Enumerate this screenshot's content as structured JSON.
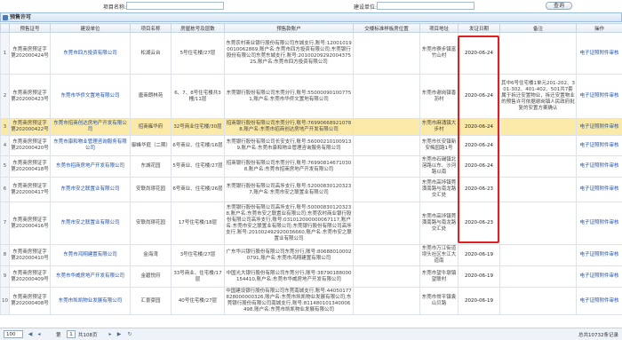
{
  "search": {
    "project_label": "项目名称:",
    "company_label": "建设单位:",
    "project_value": "",
    "company_value": "",
    "button": "查询"
  },
  "panel_title": "预售许可",
  "columns": [
    "",
    "预售证号",
    "建设单位",
    "项目名称",
    "房屋栋号及层数",
    "预售款账户",
    "交楼标准样板房位置",
    "项目地址",
    "发证日期",
    "备注",
    "操作"
  ],
  "rows": [
    {
      "n": "1",
      "cert": "东莞商房预证字第202000424号",
      "company": "东莞市四方投资有限公司",
      "project": "松湖云台",
      "bld": "5号住宅楼/27层",
      "account": "东莞农村商业银行股份有限公司东城支行,账号:120010190010062869,账户名:东莞市四方投资有限公司;东莞银行股份有限公司东莞东城支行,账号:201002092920043752S,账户名:东莞市四方投资有限公司",
      "sample": "",
      "addr": "东莞市寮步镇富竹山村",
      "date": "2020-06-24",
      "remark": "",
      "op": "电子证照附件审核"
    },
    {
      "n": "2",
      "cert": "东莞商房预证字第202000423号",
      "company": "东莞市华侨文置地有限公司",
      "project": "唐商朗林苑",
      "bld": "6、7、8号住宅楼共3幢/11层",
      "account": "东莞银行股份有限公司东莞分行,账号:550000901007751,账户名:东莞市华侨文置地有限公司",
      "sample": "",
      "addr": "东莞市谢岗镇香沥村",
      "date": "2020-06-24",
      "remark": "其中6号住宅楼1单元201-202、301-302、401-402、501共7套属于拆迁安置物业，拆迁安置物业的预售许可依据谢岗镇人民政府批复的安置方案确认",
      "op": "电子证照附件审核"
    },
    {
      "n": "3",
      "cert": "东莞商房预证字第202000422号",
      "company": "东莞市招商创达房地产开发有限公司",
      "project": "招商雍华府",
      "bld": "32号商业住宅楼/30层",
      "account": "招商银行股份有限公司东莞分行,账号:769906689210788,账户名:东莞市招商创达房地产开发有限公司",
      "sample": "",
      "addr": "东莞市麻涌镇大步村",
      "date": "2020-06-24",
      "remark": "",
      "op": "电子证照附件审核"
    },
    {
      "n": "4",
      "cert": "东莞商房预证字第202000420号",
      "company": "东莞市康和物业管理咨询服务有限公司",
      "project": "御峰华庭（二期）",
      "bld": "6号商业、住宅楼/16层",
      "account": "东莞银行股份有限公司长安支行,账号:560002101009139,账户名:东莞市康和物业管理咨询服务有限公司",
      "sample": "",
      "addr": "东莞市长安镇新安梅园路1号",
      "date": "2020-06-24",
      "remark": "",
      "op": "电子证照附件审核"
    },
    {
      "n": "5",
      "cert": "东莞商房预证字第202000418号",
      "company": "东莞市招商房地产开发有限公司",
      "project": "东城花园",
      "bld": "5号商业、住宅楼/27层",
      "account": "招商银行股份有限公司东莞分行,账号:769908146710308,账户名:东莞市招商房地产开发有限公司",
      "sample": "",
      "addr": "东莞市石碣镇北滘路以东、沙河路以南",
      "date": "2020-06-24",
      "remark": "",
      "op": "电子证照附件审核"
    },
    {
      "n": "6",
      "cert": "东莞商房预证字第202000417号",
      "company": "东莞市安之联置业有限公司",
      "project": "安联尚璟花园",
      "bld": "6号商业、住宅楼/26层",
      "account": "东莞银行股份有限公司高埗支行,账号:520008301203237,账户名:东莞市安之联置业有限公司",
      "sample": "",
      "addr": "东莞市高埗镇莞潢南路与南龙路交汇处",
      "date": "2020-06-23",
      "remark": "",
      "op": "电子证照附件审核"
    },
    {
      "n": "7",
      "cert": "东莞商房预证字第202000416号",
      "company": "东莞市安之联置业有限公司",
      "project": "安联尚璟花园",
      "bld": "17号住宅楼/18层",
      "account": "东莞银行股份有限公司高埗支行,账号:500008301203238,账户名:东莞市安之联置业有限公司;东莞农村商业银行股份有限公司高埗支行,账号:031012000000067117,账户名:东莞市安之联置业有限公司;东莞银行股份有限公司高埗支行,账号:201002492920036660,账户名:东莞市安之联置业有限公司",
      "sample": "",
      "addr": "东莞市高埗镇莞潢南路与南龙路交汇处",
      "date": "2020-06-23",
      "remark": "",
      "op": "电子证照附件审核"
    },
    {
      "n": "8",
      "cert": "东莞商房预证字第202000410号",
      "company": "东莞市鸿翔建置有限公司",
      "project": "金海湾",
      "bld": "3号住宅楼/27层",
      "account": "广东华兴银行股份有限公司东莞分行,账号:806880100020791,账户名:东莞市鸿翔建置有限公司",
      "sample": "",
      "addr": "东莞市万江街道坝头社区东江大道南",
      "date": "2020-06-19",
      "remark": "",
      "op": "电子证照附件审核"
    },
    {
      "n": "9",
      "cert": "东莞商房预证字第202000409号",
      "company": "东莞市华威房地产开发有限公司",
      "project": "金碧悦府",
      "bld": "33号商业、住宅楼/17层",
      "account": "中国光大银行股份有限公司东莞分行,账号:38790188000154410,账户名:东莞市华威房地产开发有限公司",
      "sample": "",
      "addr": "东莞市望牛墩镇望联村",
      "date": "2020-06-19",
      "remark": "",
      "op": "电子证照附件审核"
    },
    {
      "n": "10",
      "cert": "东莞商房预证字第202000408号",
      "company": "东莞市凯凯物业发展有限公司",
      "project": "汇景豪园",
      "bld": "40号住宅楼/27层",
      "account": "中国建设银行股份有限公司东莞南城支行,账号:44050177828000000326,账户名:东莞市凯凯物业发展有限公司;东莞银行股份有限公司南城支行,账号:811480101340006498,账户名:东莞市凯凯物业发展有限公司",
      "sample": "",
      "addr": "东莞市常平镇袁山贝路",
      "date": "2020-06-19",
      "remark": "",
      "op": "电子证照附件审核"
    }
  ],
  "footer": {
    "page_size": "100",
    "page_num": "1",
    "page_prefix": "第",
    "page_suffix": "共108页",
    "total": "总共10732条记录"
  }
}
